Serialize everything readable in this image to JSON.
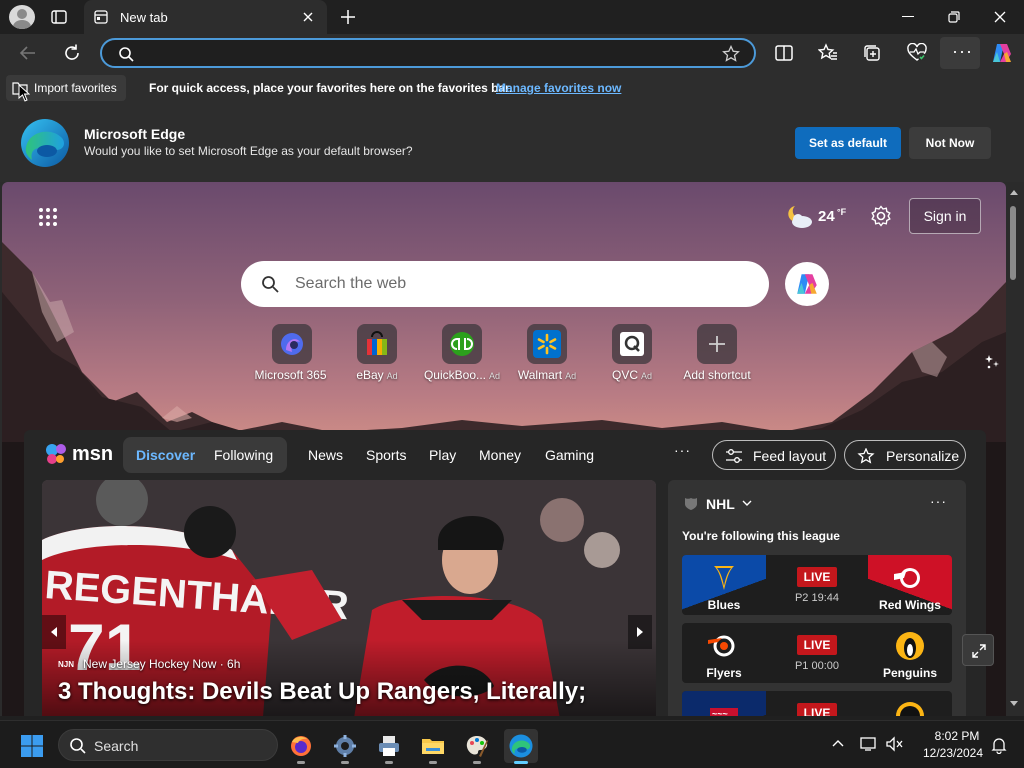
{
  "browser": {
    "tab_title": "New tab",
    "address_value": "",
    "address_placeholder": ""
  },
  "favorites_bar": {
    "import_label": "Import favorites",
    "message": "For quick access, place your favorites here on the favorites bar.",
    "manage_link": "Manage favorites now"
  },
  "banner": {
    "title": "Microsoft Edge",
    "text": "Would you like to set Microsoft Edge as your default browser?",
    "primary_button": "Set as default",
    "secondary_button": "Not Now"
  },
  "newtab": {
    "weather_temp": "24",
    "weather_unit": "°F",
    "signin_label": "Sign in",
    "search_placeholder": "Search the web",
    "shortcuts": [
      {
        "label": "Microsoft 365",
        "ad": "",
        "icon": "microsoft-365-icon"
      },
      {
        "label": "eBay",
        "ad": "Ad",
        "icon": "ebay-icon"
      },
      {
        "label": "QuickBoo...",
        "ad": "Ad",
        "icon": "quickbooks-icon"
      },
      {
        "label": "Walmart",
        "ad": "Ad",
        "icon": "walmart-icon"
      },
      {
        "label": "QVC",
        "ad": "Ad",
        "icon": "qvc-icon"
      },
      {
        "label": "Add shortcut",
        "ad": "",
        "icon": "plus-icon"
      }
    ]
  },
  "msn": {
    "logo_text": "msn",
    "tabs": {
      "discover": "Discover",
      "following": "Following"
    },
    "nav": [
      "News",
      "Sports",
      "Play",
      "Money",
      "Gaming"
    ],
    "more": "···",
    "feed_layout_label": "Feed layout",
    "personalize_label": "Personalize",
    "hero": {
      "source": "New Jersey Hockey Now · 6h",
      "source_badge": "NJN",
      "title": "3 Thoughts: Devils Beat Up Rangers, Literally;",
      "jersey_text": "REGENTHALER",
      "jersey_number": "71"
    },
    "nhl": {
      "title": "NHL",
      "subtitle": "You're following this league",
      "games": [
        {
          "home": "Blues",
          "away": "Red Wings",
          "status": "LIVE",
          "time": "P2 19:44",
          "home_color": "#0b4aa8",
          "away_color": "#ce1126"
        },
        {
          "home": "Flyers",
          "away": "Penguins",
          "status": "LIVE",
          "time": "P1 00:00",
          "home_color": "#1e1e1e",
          "away_color": "#1e1e1e"
        },
        {
          "home": "",
          "away": "",
          "status": "LIVE",
          "time": "",
          "home_color": "#0b2a6b",
          "away_color": "#1e1e1e"
        }
      ]
    }
  },
  "taskbar": {
    "search_label": "Search",
    "time": "8:02 PM",
    "date": "12/23/2024",
    "apps": [
      "firefox-icon",
      "settings-icon",
      "printer-icon",
      "file-explorer-icon",
      "paint-icon",
      "edge-icon"
    ]
  }
}
